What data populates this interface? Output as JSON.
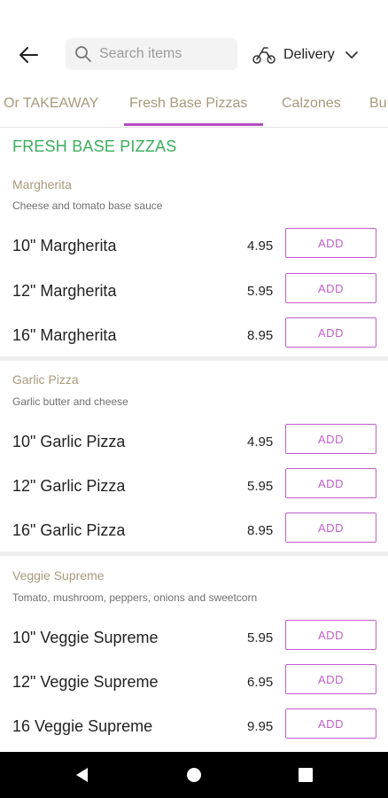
{
  "header": {
    "search_placeholder": "Search items",
    "delivery_label": "Delivery"
  },
  "tabs": [
    {
      "label": "Or TAKEAWAY"
    },
    {
      "label": "Fresh Base Pizzas"
    },
    {
      "label": "Calzones"
    },
    {
      "label": "Bu"
    }
  ],
  "section": {
    "title": "FRESH BASE PIZZAS"
  },
  "groups": [
    {
      "name": "Margherita",
      "description": "Cheese and tomato base sauce",
      "items": [
        {
          "name": "10\" Margherita",
          "price": "4.95",
          "button": "ADD"
        },
        {
          "name": "12\" Margherita",
          "price": "5.95",
          "button": "ADD"
        },
        {
          "name": "16\" Margherita",
          "price": "8.95",
          "button": "ADD"
        }
      ]
    },
    {
      "name": "Garlic Pizza",
      "description": "Garlic butter and cheese",
      "items": [
        {
          "name": "10\" Garlic Pizza",
          "price": "4.95",
          "button": "ADD"
        },
        {
          "name": "12\" Garlic Pizza",
          "price": "5.95",
          "button": "ADD"
        },
        {
          "name": "16\" Garlic Pizza",
          "price": "8.95",
          "button": "ADD"
        }
      ]
    },
    {
      "name": "Veggie Supreme",
      "description": "Tomato, mushroom, peppers, onions and sweetcorn",
      "items": [
        {
          "name": "10\" Veggie Supreme",
          "price": "5.95",
          "button": "ADD"
        },
        {
          "name": "12\" Veggie Supreme",
          "price": "6.95",
          "button": "ADD"
        },
        {
          "name": "16 Veggie Supreme",
          "price": "9.95",
          "button": "ADD"
        }
      ]
    }
  ],
  "colors": {
    "accent": "#c15fca",
    "section_title": "#3dae5c",
    "group_name": "#a89a7a"
  }
}
